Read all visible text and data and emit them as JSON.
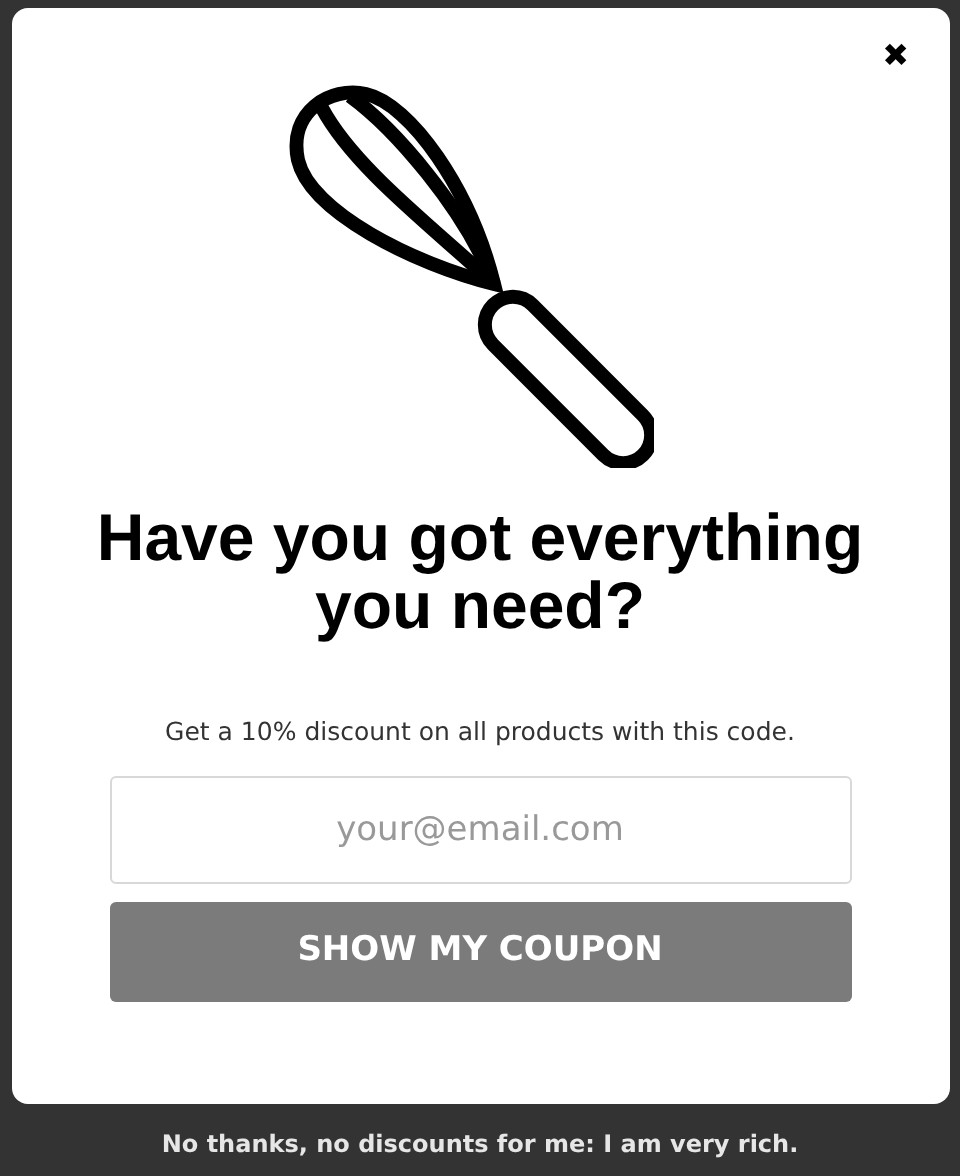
{
  "close": "✖",
  "heading": "Have you got everything you need?",
  "subtitle": "Get a 10% discount on all products with this code.",
  "email_field": {
    "placeholder": "your@email.com"
  },
  "button": "SHOW MY COUPON",
  "decline_link": "No thanks, no discounts for me: I am very rich."
}
